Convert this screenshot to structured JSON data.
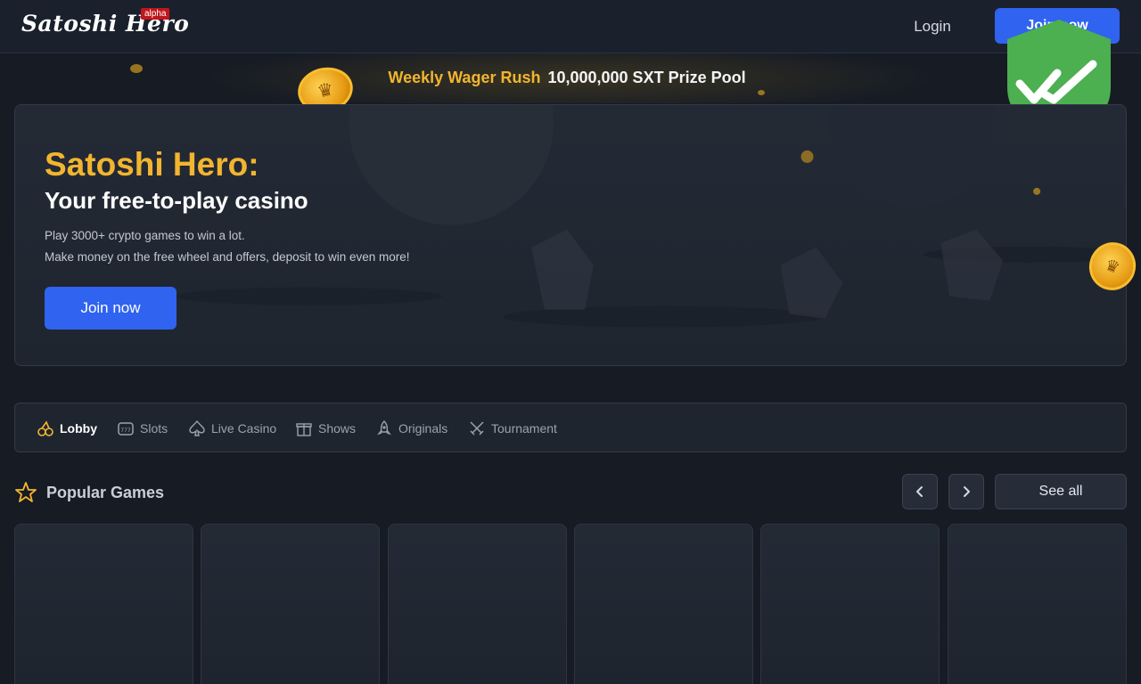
{
  "header": {
    "logo_text": "Satoshi Hero",
    "badge": "alpha",
    "login_label": "Login",
    "signup_label": "Join now"
  },
  "promo": {
    "accent": "Weekly Wager Rush",
    "text": "10,000,000 SXT Prize Pool"
  },
  "hero": {
    "title": "Satoshi Hero:",
    "subtitle": "Your free-to-play casino",
    "line1": "Play 3000+ crypto games to win a lot.",
    "line2": "Make money on the free wheel and offers, deposit to win even more!",
    "cta_label": "Join now"
  },
  "categories": [
    {
      "label": "Lobby",
      "icon": "cherries-icon",
      "active": true
    },
    {
      "label": "Slots",
      "icon": "slot-machine-icon",
      "active": false
    },
    {
      "label": "Live Casino",
      "icon": "spade-icon",
      "active": false
    },
    {
      "label": "Shows",
      "icon": "gift-icon",
      "active": false
    },
    {
      "label": "Originals",
      "icon": "rocket-icon",
      "active": false
    },
    {
      "label": "Tournament",
      "icon": "crossed-swords-icon",
      "active": false
    }
  ],
  "popular": {
    "title": "Popular Games",
    "see_all_label": "See all",
    "prev_icon": "chevron-left-icon",
    "next_icon": "chevron-right-icon"
  },
  "colors": {
    "accent_gold": "#f2b52f",
    "primary_blue": "#2f63f0",
    "background": "#161b24",
    "shield_green": "#4caf50"
  }
}
